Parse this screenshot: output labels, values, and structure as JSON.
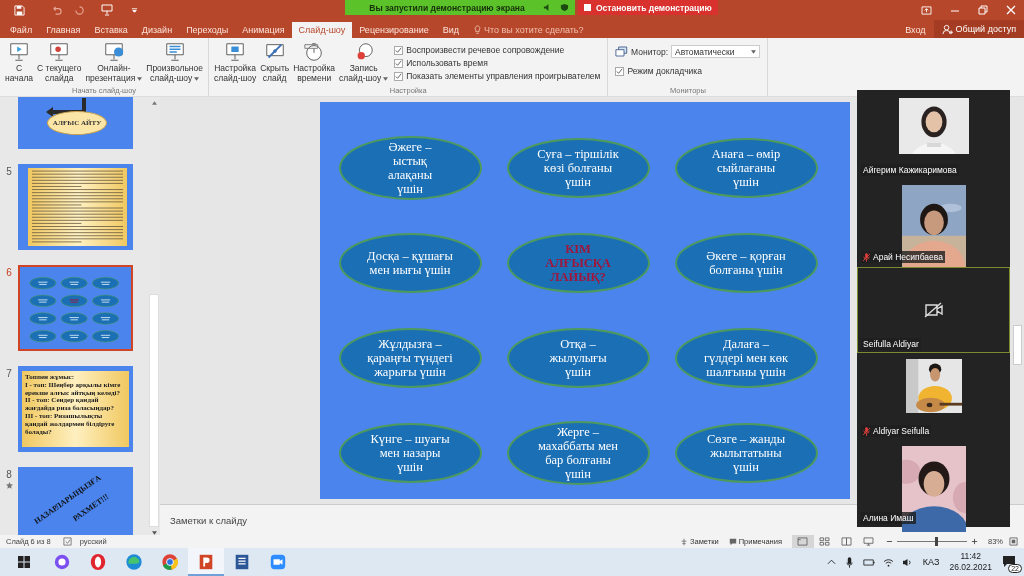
{
  "share_banner": {
    "text": "Вы запустили демонстрацию экрана",
    "stop_label": "Остановить демонстрацию"
  },
  "tabs": [
    {
      "label": "Файл",
      "selected": false
    },
    {
      "label": "Главная",
      "selected": false
    },
    {
      "label": "Вставка",
      "selected": false
    },
    {
      "label": "Дизайн",
      "selected": false
    },
    {
      "label": "Переходы",
      "selected": false
    },
    {
      "label": "Анимация",
      "selected": false
    },
    {
      "label": "Слайд-шоу",
      "selected": true
    },
    {
      "label": "Рецензирование",
      "selected": false
    },
    {
      "label": "Вид",
      "selected": false
    }
  ],
  "tell_me": {
    "placeholder": "Что вы хотите сделать?"
  },
  "account": {
    "sign_in": "Вход",
    "share": "Общий доступ"
  },
  "ribbon": {
    "groups": [
      {
        "label": "Начать слайд-шоу",
        "items": [
          {
            "kind": "button",
            "label": "С\nначала",
            "dropdown": false
          },
          {
            "kind": "button",
            "label": "С текущего\nслайда",
            "dropdown": false
          },
          {
            "kind": "button",
            "label": "Онлайн-\nпрезентация",
            "dropdown": true
          },
          {
            "kind": "button",
            "label": "Произвольное\nслайд-шоу",
            "dropdown": true
          }
        ]
      },
      {
        "label": "Настройка",
        "items": [
          {
            "kind": "button",
            "label": "Настройка\nслайд-шоу",
            "dropdown": false
          },
          {
            "kind": "button",
            "label": "Скрыть\nслайд",
            "dropdown": false
          },
          {
            "kind": "button",
            "label": "Настройка\nвремени",
            "dropdown": false
          },
          {
            "kind": "button",
            "label": "Запись\nслайд-шоу",
            "dropdown": true
          },
          {
            "kind": "checklist",
            "checks": [
              {
                "label": "Воспроизвести речевое сопровождение",
                "checked": true
              },
              {
                "label": "Использовать время",
                "checked": true
              },
              {
                "label": "Показать элементы управления проигрывателем",
                "checked": true
              }
            ]
          }
        ]
      },
      {
        "label": "Мониторы",
        "items": [
          {
            "kind": "monitor",
            "label": "Монитор:",
            "value": "Автоматически",
            "check": {
              "label": "Режим докладчика",
              "checked": true
            }
          }
        ]
      }
    ]
  },
  "thumbnails": [
    {
      "kind": "title-oval",
      "text": "АЛҒЫС АЙТУ",
      "selected": false
    },
    {
      "kind": "text-page",
      "number": "5",
      "selected": false
    },
    {
      "kind": "ovals",
      "number": "6",
      "selected": true
    },
    {
      "kind": "text-box",
      "number": "7",
      "text": "Топпен жұмыс:\n І - топ: Шеңбер арқылы кімге ерекше алғыс айтқың келеді?\n ІІ - топ: Сендер қандай жағдайда риза боласыңдар?\n ІІІ - топ: Ризашылықты қандай жолдармен білдіруге болады?",
      "selected": false
    },
    {
      "kind": "rotated-title",
      "number": "8",
      "lines": [
        "НАЗАРЛАРЫҢЫЗҒА",
        "РАХМЕТ!!!"
      ],
      "animated": true,
      "selected": false
    }
  ],
  "slide": {
    "ovals": [
      {
        "kind": "answer",
        "text": "Әжеге –\nыстық\nалақаны\nүшін"
      },
      {
        "kind": "answer",
        "text": "Суға – тіршілік\nкөзі болғаны\nүшін"
      },
      {
        "kind": "answer",
        "text": "Анаға – өмір\nсыйлағаны\nүшін"
      },
      {
        "kind": "answer",
        "text": "Досқа – құшағы\nмен иығы үшін"
      },
      {
        "kind": "question",
        "text": "КІМ\nАЛҒЫСҚА\nЛАЙЫҚ?"
      },
      {
        "kind": "answer",
        "text": "Әкеге – қорған\nболғаны үшін"
      },
      {
        "kind": "answer",
        "text": "Жұлдызға –\nқараңғы түндегі\nжарығы үшін"
      },
      {
        "kind": "answer",
        "text": "Отқа –\nжылулығы\nүшін"
      },
      {
        "kind": "answer",
        "text": "Далаға –\nгүлдері мен көк\nшалғыны үшін"
      },
      {
        "kind": "answer",
        "text": "Күнге – шуағы\nмен назары\nүшін"
      },
      {
        "kind": "answer",
        "text": "Жерге –\nмахаббаты мен\nбар болғаны\nүшін"
      },
      {
        "kind": "answer",
        "text": "Сөзге – жанды\nжылытатыны\nүшін"
      }
    ]
  },
  "notes": {
    "placeholder": "Заметки к слайду"
  },
  "participants": [
    {
      "name": "Айгерим Кажикаримова",
      "video": true,
      "muted": false,
      "speaking": false
    },
    {
      "name": "Арай Несипбаева",
      "video": true,
      "muted": true,
      "speaking": false
    },
    {
      "name": "Seifulla Aldiyar",
      "video": false,
      "muted": false,
      "speaking": true
    },
    {
      "name": "Aldiyar Seifulla",
      "video": true,
      "muted": true,
      "speaking": false
    },
    {
      "name": "Алина Имаш",
      "video": true,
      "muted": false,
      "speaking": false
    }
  ],
  "status_bar": {
    "slide_info": "Слайд 6 из 8",
    "language": "русский",
    "notes": "Заметки",
    "comments": "Примечания",
    "views": [
      {
        "selected": true
      },
      {
        "selected": false
      },
      {
        "selected": false
      },
      {
        "selected": false
      }
    ],
    "zoom": {
      "level": 0.55,
      "percent": "83%"
    }
  },
  "taskbar": {
    "apps": [
      {
        "active": false
      },
      {
        "active": false
      },
      {
        "active": false
      },
      {
        "active": false
      },
      {
        "active": true
      },
      {
        "active": false
      },
      {
        "active": false
      }
    ],
    "language": "КАЗ",
    "time": "11:42",
    "date": "26.02.2021",
    "notifications": "22"
  }
}
